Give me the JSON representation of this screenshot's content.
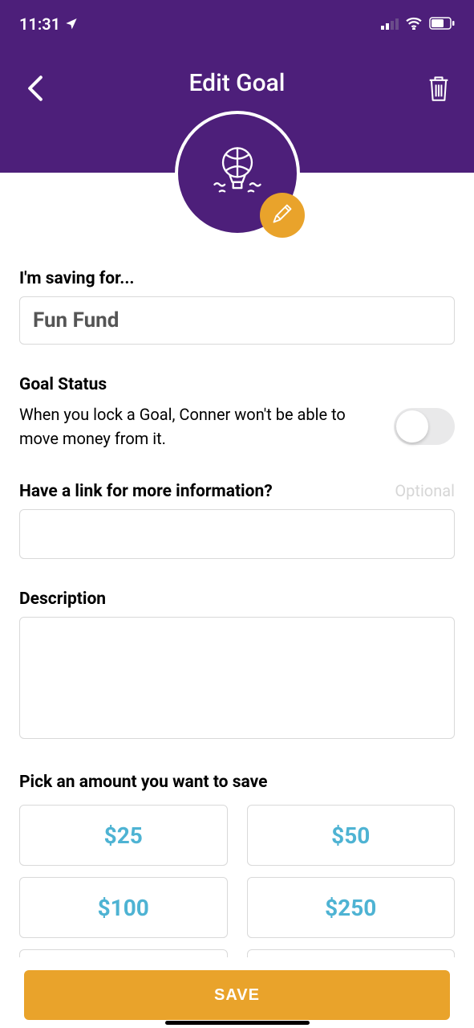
{
  "status_bar": {
    "time": "11:31"
  },
  "header": {
    "title": "Edit Goal"
  },
  "form": {
    "saving_for_label": "I'm saving for...",
    "saving_for_value": "Fun Fund",
    "goal_status_label": "Goal Status",
    "goal_status_desc": "When you lock a Goal, Conner won't be able to move money from it.",
    "link_label": "Have a link for more information?",
    "link_optional": "Optional",
    "link_value": "",
    "description_label": "Description",
    "description_value": "",
    "amount_label": "Pick an amount you want to save",
    "amounts": [
      "$25",
      "$50",
      "$100",
      "$250"
    ],
    "save_label": "SAVE"
  }
}
